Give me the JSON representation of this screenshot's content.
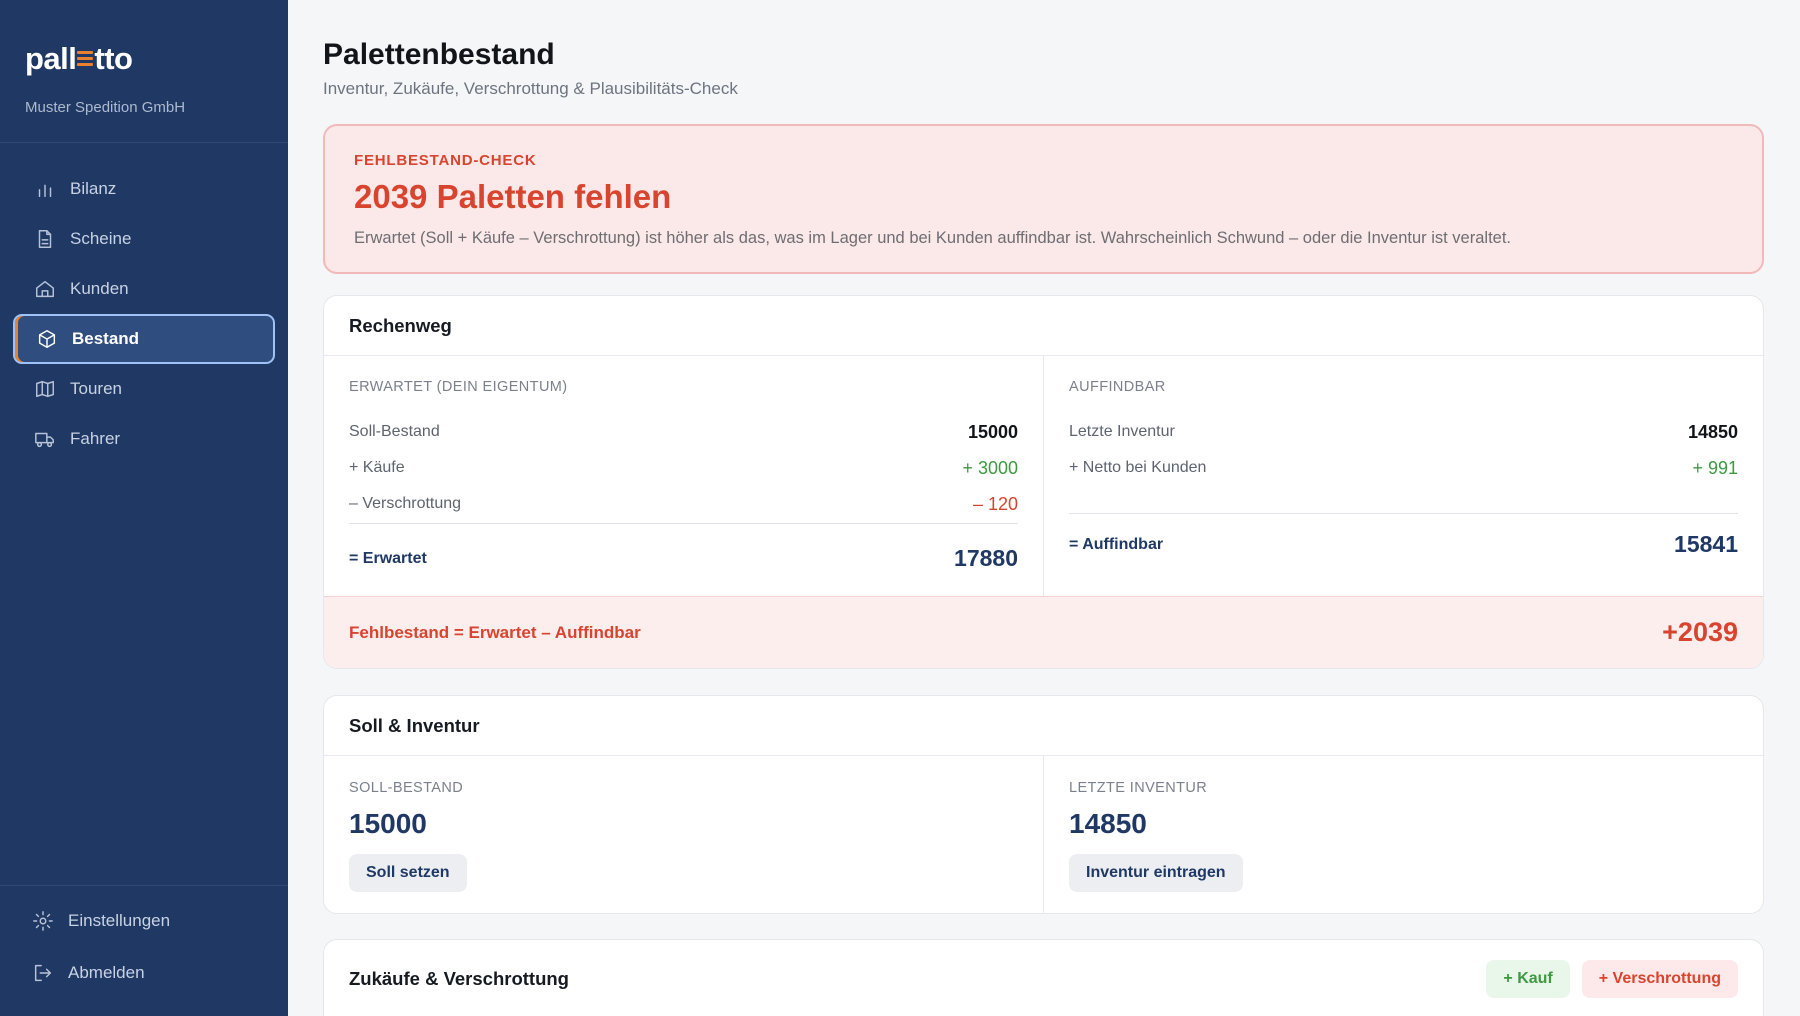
{
  "sidebar": {
    "brand": {
      "logo_left": "pall",
      "logo_right": "tto",
      "company": "Muster Spedition GmbH"
    },
    "items": [
      {
        "label": "Bilanz",
        "icon": "bar-chart-icon"
      },
      {
        "label": "Scheine",
        "icon": "document-icon"
      },
      {
        "label": "Kunden",
        "icon": "home-icon"
      },
      {
        "label": "Bestand",
        "icon": "box-icon",
        "active": true
      },
      {
        "label": "Touren",
        "icon": "map-icon"
      },
      {
        "label": "Fahrer",
        "icon": "truck-icon"
      }
    ],
    "bottom": [
      {
        "label": "Einstellungen",
        "icon": "gear-icon"
      },
      {
        "label": "Abmelden",
        "icon": "logout-icon"
      }
    ]
  },
  "header": {
    "title": "Palettenbestand",
    "subtitle": "Inventur, Zukäufe, Verschrottung & Plausibilitäts-Check"
  },
  "alert": {
    "kicker": "FEHLBESTAND-CHECK",
    "title": "2039 Paletten fehlen",
    "text": "Erwartet (Soll + Käufe – Verschrottung) ist höher als das, was im Lager und bei Kunden auffindbar ist. Wahrscheinlich Schwund – oder die Inventur ist veraltet."
  },
  "rechenweg": {
    "title": "Rechenweg",
    "expected": {
      "label": "ERWARTET (DEIN EIGENTUM)",
      "rows": [
        {
          "label": "Soll-Bestand",
          "value": "15000"
        },
        {
          "label": "+ Käufe",
          "value": "+ 3000"
        },
        {
          "label": "– Verschrottung",
          "value": "– 120"
        }
      ],
      "total_label": "= Erwartet",
      "total_value": "17880"
    },
    "findable": {
      "label": "AUFFINDBAR",
      "rows": [
        {
          "label": "Letzte Inventur",
          "value": "14850"
        },
        {
          "label": "+ Netto bei Kunden",
          "value": "+ 991"
        }
      ],
      "total_label": "= Auffindbar",
      "total_value": "15841"
    },
    "result_label": "Fehlbestand = Erwartet – Auffindbar",
    "result_value": "+2039"
  },
  "soll_inventur": {
    "title": "Soll & Inventur",
    "soll": {
      "label": "SOLL-BESTAND",
      "value": "15000",
      "button": "Soll setzen"
    },
    "inventur": {
      "label": "LETZTE INVENTUR",
      "value": "14850",
      "button": "Inventur eintragen"
    }
  },
  "zukaeufe": {
    "title": "Zukäufe & Verschrottung",
    "buy_button": "+ Kauf",
    "scrap_button": "+ Verschrottung"
  },
  "colors": {
    "sidebar_bg": "#1f3864",
    "accent": "#e8812f",
    "danger": "#d9442f",
    "success": "#3d9a40",
    "navy_text": "#1f3864"
  }
}
